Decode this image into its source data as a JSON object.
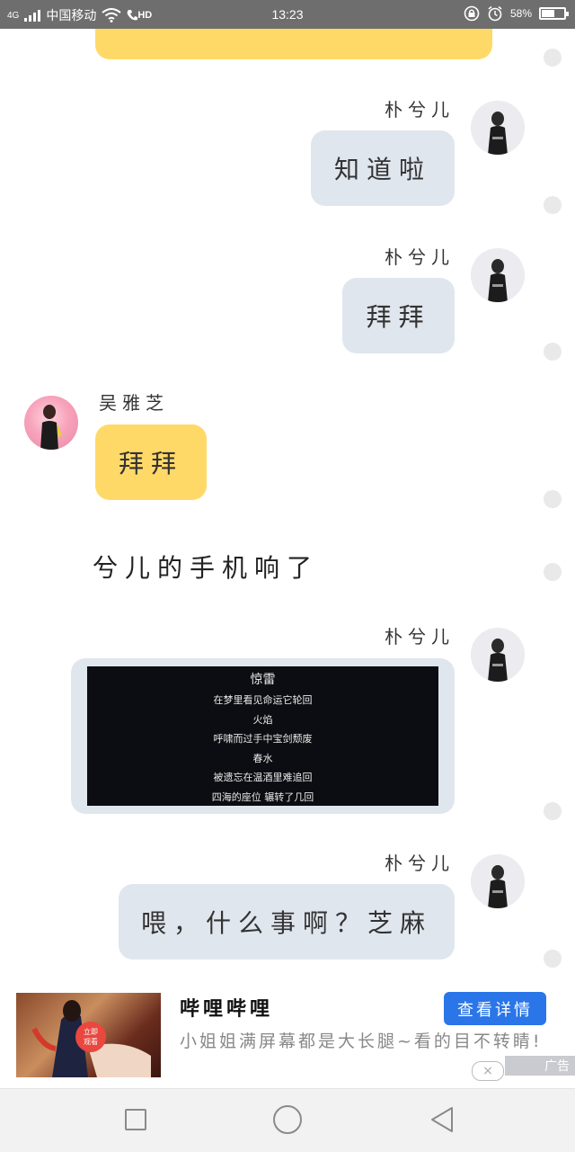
{
  "status_bar": {
    "network": "4G",
    "carrier": "中国移动",
    "hd": "HD",
    "time": "13:23",
    "battery": "58%",
    "battery_level": 0.58
  },
  "messages": [
    {
      "type": "text",
      "side": "right",
      "sender": "朴兮儿",
      "text": "知道啦"
    },
    {
      "type": "text",
      "side": "right",
      "sender": "朴兮儿",
      "text": "拜拜"
    },
    {
      "type": "text",
      "side": "left",
      "sender": "吴雅芝",
      "text": "拜拜"
    },
    {
      "type": "narration",
      "text": "兮儿的手机响了"
    },
    {
      "type": "image",
      "side": "right",
      "sender": "朴兮儿",
      "song_title": "惊雷",
      "lyrics": [
        "在梦里看见命运它轮回",
        "火焰",
        "呼啸而过手中宝剑颓废",
        "春水",
        "被遗忘在温酒里难追回",
        "四海的座位 辗转了几回"
      ]
    },
    {
      "type": "text",
      "side": "right",
      "sender": "朴兮儿",
      "text": "喂，什么事啊？芝麻"
    }
  ],
  "ad": {
    "title": "哔哩哔哩",
    "description": "小姐姐满屏幕都是大长腿~看的目不转睛!",
    "cta": "查看详情",
    "badge_line1": "立即",
    "badge_line2": "观看",
    "close": "×",
    "label": "广告"
  },
  "colors": {
    "status_bar": "#6e6e6e",
    "bubble_self": "#e0e6ee",
    "bubble_other": "#ffd968",
    "cta": "#2a76e8"
  },
  "icons": [
    "signal-icon",
    "wifi-icon",
    "hd-call-icon",
    "lock-rotation-icon",
    "alarm-icon",
    "battery-icon",
    "recent-apps-icon",
    "home-icon",
    "back-icon",
    "close-icon"
  ]
}
